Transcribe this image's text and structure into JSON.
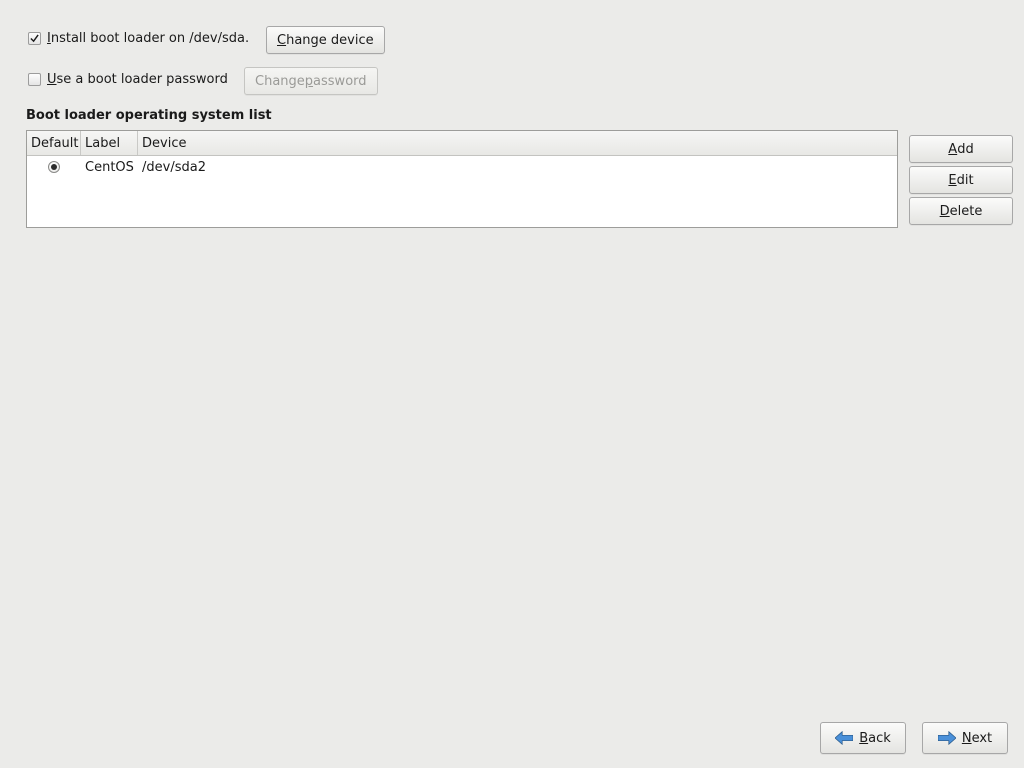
{
  "install_bootloader": {
    "checked": true,
    "label_html": "<span class='mn'>I</span>nstall boot loader on /dev/sda.",
    "change_device_label_html": "<span class='mn'>C</span>hange device"
  },
  "use_password": {
    "checked": false,
    "label_html": "<span class='mn'>U</span>se a boot loader password",
    "change_password_label_html": "Change <span class='mn'>p</span>assword"
  },
  "os_list_title": "Boot loader operating system list",
  "os_table": {
    "headers": {
      "default": "Default",
      "label": "Label",
      "device": "Device"
    },
    "rows": [
      {
        "default": true,
        "label": "CentOS",
        "device": "/dev/sda2"
      }
    ]
  },
  "side_buttons": {
    "add_html": "<span class='mn'>A</span>dd",
    "edit_html": "<span class='mn'>E</span>dit",
    "delete_html": "<span class='mn'>D</span>elete"
  },
  "footer": {
    "back_html": "<span class='mn'>B</span>ack",
    "next_html": "<span class='mn'>N</span>ext"
  }
}
